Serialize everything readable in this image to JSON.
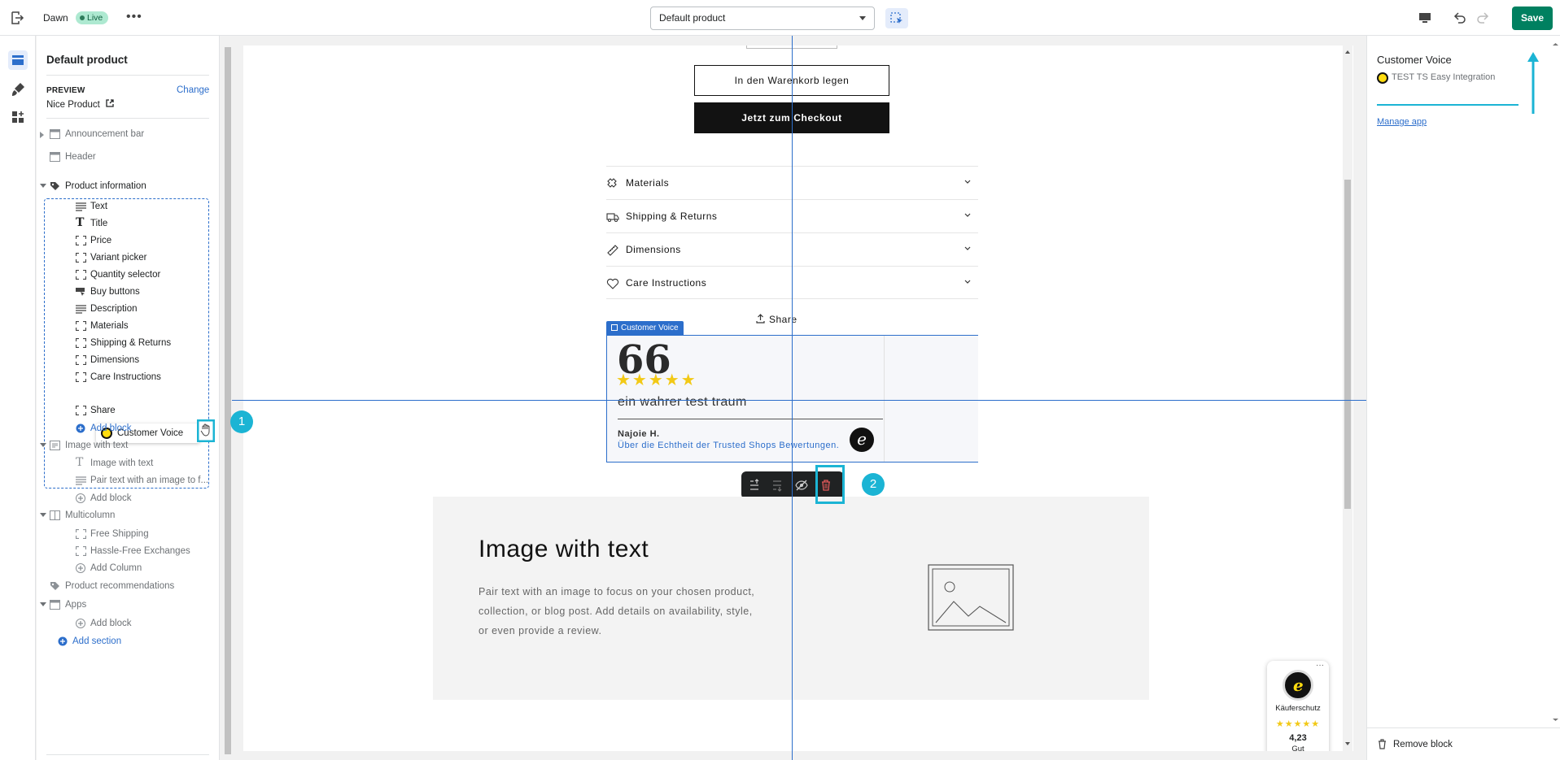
{
  "topbar": {
    "theme_name": "Dawn",
    "status": "Live",
    "template_select": "Default product",
    "save_label": "Save"
  },
  "sidebar": {
    "title": "Default product",
    "preview_label": "PREVIEW",
    "change_label": "Change",
    "preview_product": "Nice Product",
    "sections": {
      "announcement": "Announcement bar",
      "header": "Header",
      "product_info": "Product information",
      "product_blocks": [
        "Text",
        "Title",
        "Price",
        "Variant picker",
        "Quantity selector",
        "Buy buttons",
        "Description",
        "Materials",
        "Shipping & Returns",
        "Dimensions",
        "Care Instructions"
      ],
      "dragging_block": "Customer Voice",
      "share": "Share",
      "add_block": "Add block",
      "image_with_text": "Image with text",
      "iwt_blocks": [
        "Image with text",
        "Pair text with an image to f..."
      ],
      "multicolumn": "Multicolumn",
      "mc_blocks": [
        "Free Shipping",
        "Hassle-Free Exchanges"
      ],
      "add_column": "Add Column",
      "product_recs": "Product recommendations",
      "apps": "Apps",
      "add_section": "Add section"
    }
  },
  "preview": {
    "add_to_cart": "In den Warenkorb legen",
    "checkout": "Jetzt zum Checkout",
    "accordions": [
      "Materials",
      "Shipping & Returns",
      "Dimensions",
      "Care Instructions"
    ],
    "share": "Share",
    "cv_tag": "Customer Voice",
    "review": {
      "quote_mark": "66",
      "stars": "★★★★★",
      "text": "ein wahrer test traum",
      "author": "Najoie H.",
      "link": "Über die Echtheit der Trusted Shops Bewertungen.",
      "logo_letter": "e"
    },
    "step_badges": [
      "1",
      "2"
    ],
    "image_with_text": {
      "heading": "Image with text",
      "body": "Pair text with an image to focus on your chosen product, collection, or blog post. Add details on availability, style, or even provide a review."
    },
    "ts_widget": {
      "more": "···",
      "label": "Käuferschutz",
      "stars": "★★★★★",
      "score": "4,23",
      "grade": "Gut"
    }
  },
  "rpanel": {
    "title": "Customer Voice",
    "app_name": "TEST TS Easy Integration",
    "manage_app": "Manage app",
    "remove_block": "Remove block"
  },
  "colors": {
    "save": "#008060",
    "accent_blue": "#2c6ecb",
    "annotation_cyan": "#1bb4d4",
    "star": "#f2c916"
  }
}
